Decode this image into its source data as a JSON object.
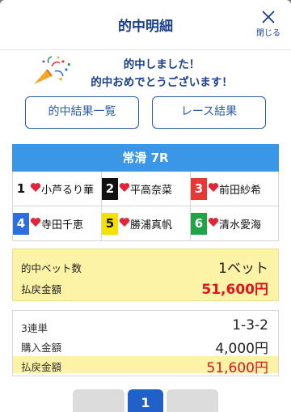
{
  "header": {
    "title": "的中明細",
    "close_label": "閉じる"
  },
  "hit_message": {
    "line1": "的中しました！",
    "line2": "的中おめでとうございます！"
  },
  "buttons": {
    "results_list": "的中結果一覧",
    "race_results": "レース結果"
  },
  "race": {
    "name": "常滑 7R"
  },
  "entries": [
    {
      "num": "1",
      "name": "小芦るり華",
      "bg": "#ffffff",
      "fg": "#111111"
    },
    {
      "num": "2",
      "name": "平高奈菜",
      "bg": "#111111",
      "fg": "#ffffff"
    },
    {
      "num": "3",
      "name": "前田紗希",
      "bg": "#e53935",
      "fg": "#ffffff"
    },
    {
      "num": "4",
      "name": "寺田千恵",
      "bg": "#2e6fe0",
      "fg": "#ffffff"
    },
    {
      "num": "5",
      "name": "勝浦真帆",
      "bg": "#f5e100",
      "fg": "#111111"
    },
    {
      "num": "6",
      "name": "清水愛海",
      "bg": "#22a34a",
      "fg": "#ffffff"
    }
  ],
  "summary": {
    "hit_bets_label": "的中ベット数",
    "hit_bets_value": "1ベット",
    "payout_label": "払戻金額",
    "payout_value": "51,600円"
  },
  "detail": {
    "bet_type_label": "3連単",
    "bet_combo": "1-3-2",
    "purchase_label": "購入金額",
    "purchase_value": "4,000円",
    "payout_label": "払戻金額",
    "payout_value": "51,600円"
  },
  "pagination": {
    "current": "1"
  },
  "colors": {
    "primary": "#1a3f8c",
    "race_header": "#3a96e6",
    "highlight": "#fdf3a6",
    "payout_red": "#e0141e",
    "heart": "#e0243a"
  }
}
